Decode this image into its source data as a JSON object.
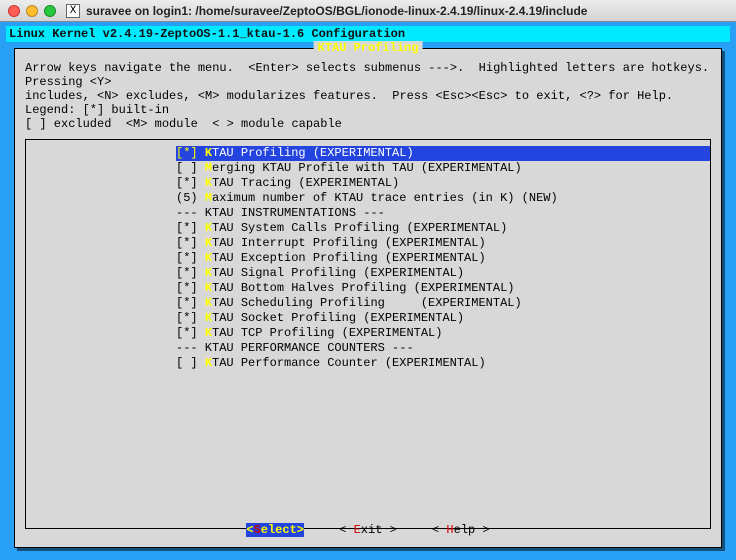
{
  "window": {
    "title": "suravee on login1: /home/suravee/ZeptoOS/BGL/ionode-linux-2.4.19/linux-2.4.19/include"
  },
  "config_header": "Linux Kernel v2.4.19-ZeptoOS-1.1_ktau-1.6 Configuration",
  "frame_title": "KTAU Profiling",
  "help_text": "Arrow keys navigate the menu.  <Enter> selects submenus --->.  Highlighted letters are hotkeys.  Pressing <Y>\nincludes, <N> excludes, <M> modularizes features.  Press <Esc><Esc> to exit, <?> for Help.  Legend: [*] built-in\n[ ] excluded  <M> module  < > module capable",
  "items": [
    {
      "prefix": "[*] ",
      "hot": "K",
      "tail": "TAU Profiling (EXPERIMENTAL)",
      "sel": true
    },
    {
      "prefix": "[ ] ",
      "hot": "M",
      "tail": "erging KTAU Profile with TAU (EXPERIMENTAL)"
    },
    {
      "prefix": "[*] ",
      "hot": "K",
      "tail": "TAU Tracing (EXPERIMENTAL)"
    },
    {
      "prefix": "(5) ",
      "hot": "M",
      "tail": "aximum number of KTAU trace entries (in K) (NEW)"
    },
    {
      "prefix": "--- KTAU INSTRUMENTATIONS ---",
      "sep": true
    },
    {
      "prefix": "[*] ",
      "hot": "K",
      "tail": "TAU System Calls Profiling (EXPERIMENTAL)"
    },
    {
      "prefix": "[*] ",
      "hot": "K",
      "tail": "TAU Interrupt Profiling (EXPERIMENTAL)"
    },
    {
      "prefix": "[*] ",
      "hot": "K",
      "tail": "TAU Exception Profiling (EXPERIMENTAL)"
    },
    {
      "prefix": "[*] ",
      "hot": "K",
      "tail": "TAU Signal Profiling (EXPERIMENTAL)"
    },
    {
      "prefix": "[*] ",
      "hot": "K",
      "tail": "TAU Bottom Halves Profiling (EXPERIMENTAL)"
    },
    {
      "prefix": "[*] ",
      "hot": "K",
      "tail": "TAU Scheduling Profiling     (EXPERIMENTAL)"
    },
    {
      "prefix": "[*] ",
      "hot": "K",
      "tail": "TAU Socket Profiling (EXPERIMENTAL)"
    },
    {
      "prefix": "[*] ",
      "hot": "K",
      "tail": "TAU TCP Profiling (EXPERIMENTAL)"
    },
    {
      "prefix": "--- KTAU PERFORMANCE COUNTERS ---",
      "sep": true
    },
    {
      "prefix": "[ ] ",
      "hot": "K",
      "tail": "TAU Performance Counter (EXPERIMENTAL)"
    }
  ],
  "buttons": {
    "select": {
      "open": "<",
      "hot": "S",
      "tail": "elect>",
      "selected": true
    },
    "exit": {
      "open": "< ",
      "hot": "E",
      "tail": "xit >"
    },
    "help": {
      "open": "< ",
      "hot": "H",
      "tail": "elp >"
    }
  }
}
